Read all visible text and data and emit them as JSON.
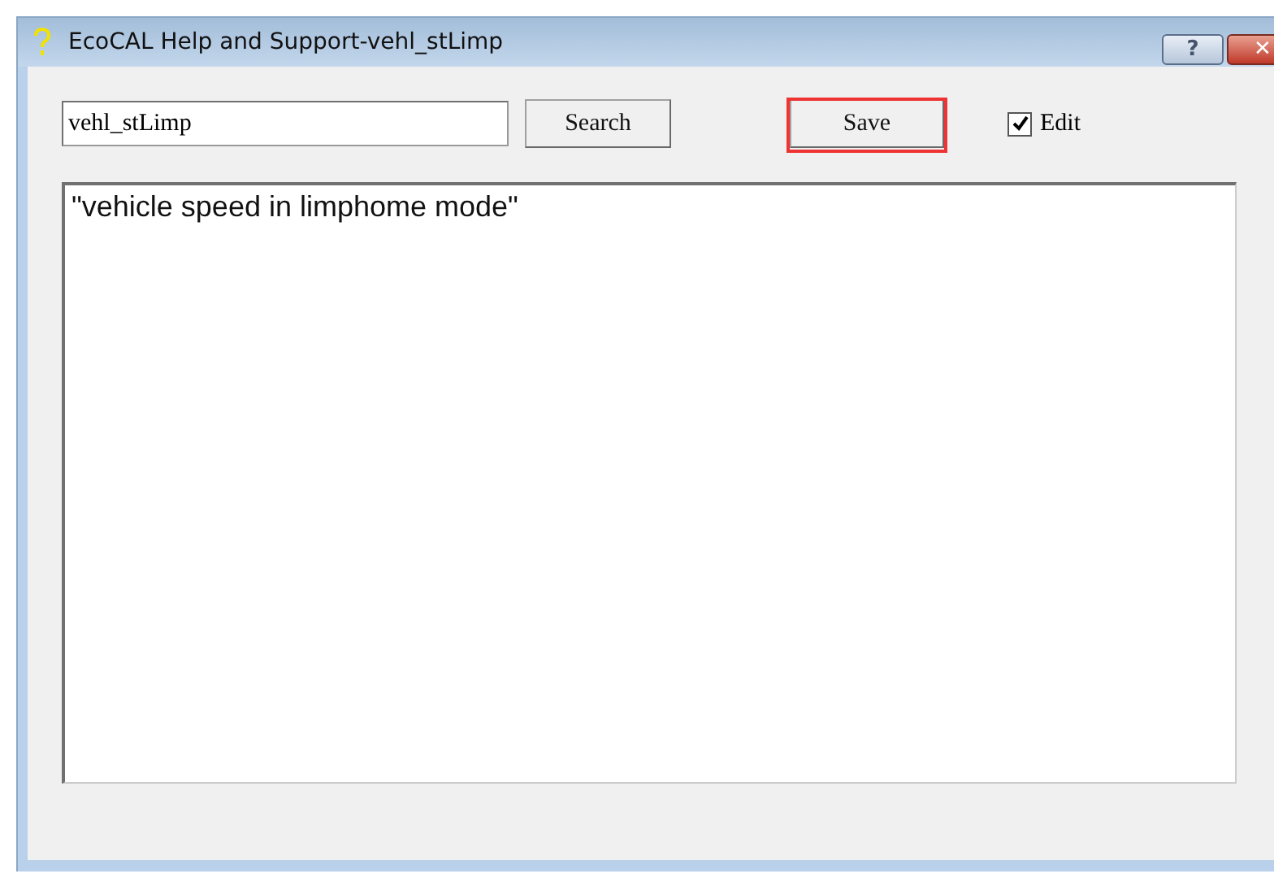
{
  "window": {
    "title": "EcoCAL Help and Support-vehl_stLimp",
    "help_button": "?",
    "close_button": "✕"
  },
  "search_field": {
    "value": "vehl_stLimp"
  },
  "search_button": {
    "label": "Search"
  },
  "save_button": {
    "label": "Save",
    "highlighted": true
  },
  "edit_checkbox": {
    "label": "Edit",
    "checked": true
  },
  "text_area": {
    "value": "\"vehicle speed in limphome mode\""
  }
}
